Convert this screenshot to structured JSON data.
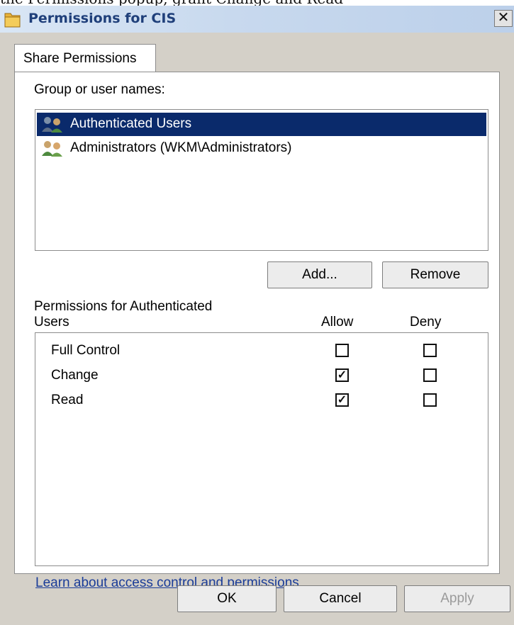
{
  "crop_text": "the Permissions popup, grant Change and Read",
  "window": {
    "title": "Permissions for CIS",
    "close_symbol": "✕"
  },
  "tabs": [
    {
      "label": "Share Permissions",
      "selected": true
    }
  ],
  "group_list": {
    "label": "Group or user names:",
    "items": [
      {
        "name": "Authenticated Users",
        "selected": true
      },
      {
        "name": "Administrators (WKM\\Administrators)",
        "selected": false
      }
    ]
  },
  "buttons": {
    "add": "Add...",
    "remove": "Remove"
  },
  "permissions": {
    "title": "Permissions for Authenticated Users",
    "allow_header": "Allow",
    "deny_header": "Deny",
    "rows": [
      {
        "name": "Full Control",
        "allow": false,
        "deny": false
      },
      {
        "name": "Change",
        "allow": true,
        "deny": false
      },
      {
        "name": "Read",
        "allow": true,
        "deny": false
      }
    ]
  },
  "help_link": "Learn about access control and permissions",
  "footer": {
    "ok": "OK",
    "cancel": "Cancel",
    "apply": "Apply",
    "apply_enabled": false
  },
  "check_glyph": "✓"
}
